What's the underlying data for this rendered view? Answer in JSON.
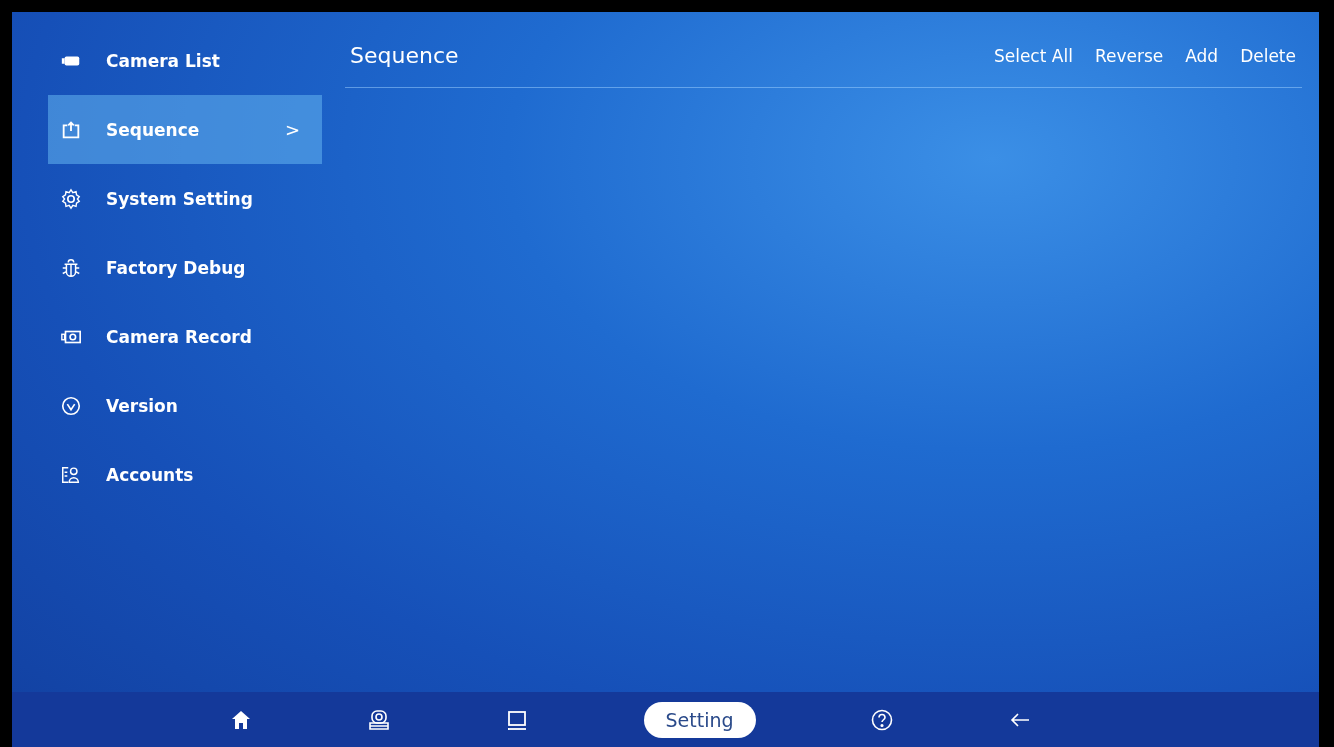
{
  "sidebar": {
    "items": [
      {
        "kind": "camera-list",
        "label": "Camera List",
        "selected": false
      },
      {
        "kind": "sequence",
        "label": "Sequence",
        "selected": true,
        "chevron": ">"
      },
      {
        "kind": "gear",
        "label": "System Setting",
        "selected": false
      },
      {
        "kind": "bug",
        "label": "Factory Debug",
        "selected": false
      },
      {
        "kind": "record",
        "label": "Camera Record",
        "selected": false
      },
      {
        "kind": "version",
        "label": "Version",
        "selected": false
      },
      {
        "kind": "accounts",
        "label": "Accounts",
        "selected": false
      }
    ]
  },
  "header": {
    "title": "Sequence",
    "actions": [
      "Select All",
      "Reverse",
      "Add",
      "Delete"
    ]
  },
  "bottom_nav": {
    "items": [
      {
        "kind": "home",
        "selected": false
      },
      {
        "kind": "camera",
        "selected": false
      },
      {
        "kind": "monitor",
        "selected": false
      },
      {
        "kind": "label",
        "label": "Setting",
        "selected": true
      },
      {
        "kind": "help",
        "selected": false
      },
      {
        "kind": "back",
        "selected": false
      }
    ]
  }
}
